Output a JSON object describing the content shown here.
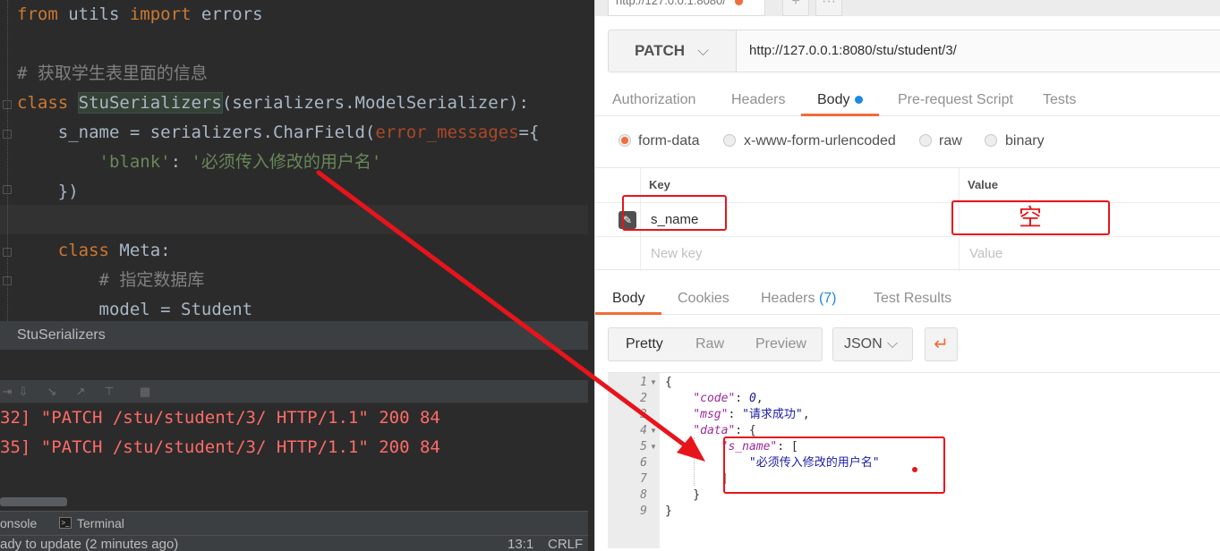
{
  "ide": {
    "code_lines": [
      {
        "parts": [
          {
            "t": "from",
            "c": "kw"
          },
          {
            "t": " utils ",
            "c": ""
          },
          {
            "t": "import",
            "c": "kw"
          },
          {
            "t": " errors",
            "c": ""
          }
        ]
      },
      {
        "parts": []
      },
      {
        "parts": [
          {
            "t": "# 获取学生表里面的信息",
            "c": "cm"
          }
        ]
      },
      {
        "parts": [
          {
            "t": "class",
            "c": "kw"
          },
          {
            "t": " ",
            "c": ""
          },
          {
            "t": "StuSerializers",
            "c": "cls-hl"
          },
          {
            "t": "(serializers.ModelSerializer):",
            "c": ""
          }
        ]
      },
      {
        "parts": [
          {
            "t": "    s_name = serializers.CharField(",
            "c": ""
          },
          {
            "t": "error_messages",
            "c": "param"
          },
          {
            "t": "={",
            "c": ""
          }
        ]
      },
      {
        "parts": [
          {
            "t": "        ",
            "c": ""
          },
          {
            "t": "'blank'",
            "c": "str"
          },
          {
            "t": ": ",
            "c": ""
          },
          {
            "t": "'必须传入修改的用户名'",
            "c": "str"
          }
        ]
      },
      {
        "parts": [
          {
            "t": "    })",
            "c": ""
          }
        ]
      },
      {
        "parts": []
      },
      {
        "parts": [
          {
            "t": "    ",
            "c": ""
          },
          {
            "t": "class",
            "c": "kw"
          },
          {
            "t": " Meta:",
            "c": ""
          }
        ]
      },
      {
        "parts": [
          {
            "t": "        # 指定数据库",
            "c": "cm"
          }
        ]
      },
      {
        "parts": [
          {
            "t": "        model = Student",
            "c": ""
          }
        ]
      }
    ],
    "breadcrumb": "StuSerializers",
    "console_lines": [
      "32] \"PATCH /stu/student/3/ HTTP/1.1\" 200 84",
      "35] \"PATCH /stu/student/3/ HTTP/1.1\" 200 84"
    ],
    "tool_tabs": [
      "onsole",
      "Terminal"
    ],
    "status_left": "ady to update (2 minutes ago)",
    "status_pos": "13:1",
    "status_eol": "CRLF"
  },
  "postman": {
    "tab_title": "http://127.0.0.1:8080/",
    "tab_plus": "+",
    "tab_more": "···",
    "method": "PATCH",
    "url": "http://127.0.0.1:8080/stu/student/3/",
    "request_tabs": [
      "Authorization",
      "Headers",
      "Body",
      "Pre-request Script",
      "Tests"
    ],
    "active_request_tab": "Body",
    "body_types": [
      "form-data",
      "x-www-form-urlencoded",
      "raw",
      "binary"
    ],
    "selected_body_type": "form-data",
    "kv": {
      "key_header": "Key",
      "value_header": "Value",
      "rows": [
        {
          "key": "s_name",
          "value": ""
        }
      ],
      "new_key_placeholder": "New key",
      "new_value_placeholder": "Value"
    },
    "response_tabs": [
      "Body",
      "Cookies",
      "Headers",
      "Test Results"
    ],
    "response_headers_count": "(7)",
    "view_modes": [
      "Pretty",
      "Raw",
      "Preview"
    ],
    "format": "JSON",
    "json_line_numbers": [
      "1",
      "2",
      "3",
      "4",
      "5",
      "6",
      "7",
      "8",
      "9"
    ],
    "json_lines": [
      [
        {
          "t": "{",
          "c": ""
        }
      ],
      [
        {
          "t": "    ",
          "c": ""
        },
        {
          "t": "\"code\"",
          "c": "jk"
        },
        {
          "t": ": ",
          "c": ""
        },
        {
          "t": "0",
          "c": "jn"
        },
        {
          "t": ",",
          "c": ""
        }
      ],
      [
        {
          "t": "    ",
          "c": ""
        },
        {
          "t": "\"msg\"",
          "c": "jk"
        },
        {
          "t": ": ",
          "c": ""
        },
        {
          "t": "\"请求成功\"",
          "c": "js"
        },
        {
          "t": ",",
          "c": ""
        }
      ],
      [
        {
          "t": "    ",
          "c": ""
        },
        {
          "t": "\"data\"",
          "c": "jk"
        },
        {
          "t": ": {",
          "c": ""
        }
      ],
      [
        {
          "t": "        ",
          "c": ""
        },
        {
          "t": "\"s_name\"",
          "c": "jk"
        },
        {
          "t": ": [",
          "c": ""
        }
      ],
      [
        {
          "t": "            ",
          "c": ""
        },
        {
          "t": "\"必须传入修改的用户名\"",
          "c": "js"
        }
      ],
      [
        {
          "t": "        ]",
          "c": ""
        }
      ],
      [
        {
          "t": "    }",
          "c": ""
        }
      ],
      [
        {
          "t": "}",
          "c": ""
        }
      ]
    ]
  },
  "annotation": {
    "empty_value_label": "空"
  },
  "colors": {
    "annotation_red": "#e8141b",
    "postman_orange": "#f26b3a",
    "accent_blue": "#1e88e5"
  }
}
